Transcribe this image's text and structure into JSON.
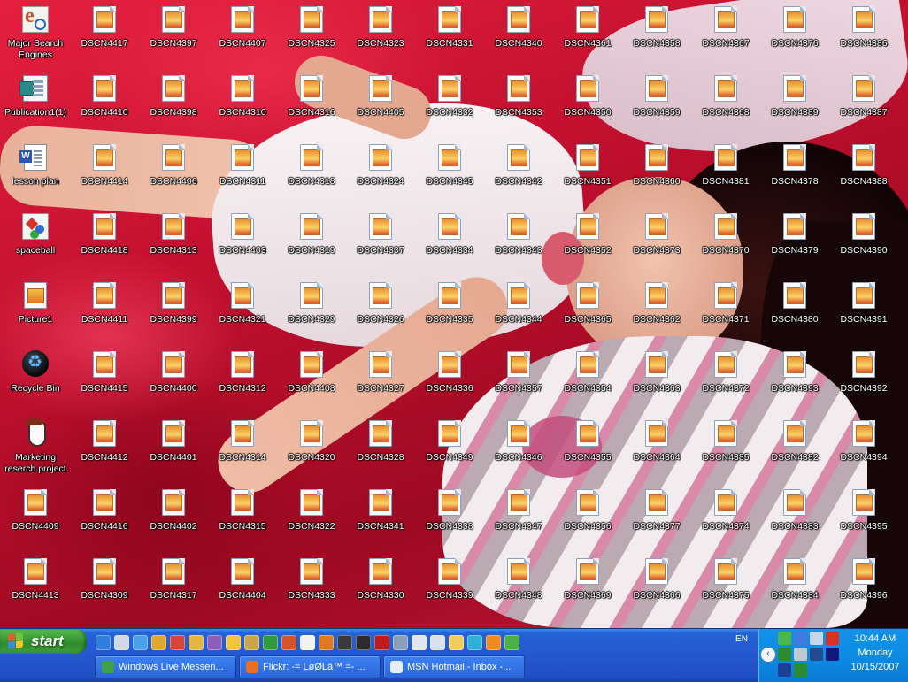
{
  "desktop": {
    "icons": [
      {
        "label": "Major Search Engines",
        "type": "ie"
      },
      {
        "label": "Publication1(1)",
        "type": "pub"
      },
      {
        "label": "lesson plan",
        "type": "doc"
      },
      {
        "label": "spaceball",
        "type": "space"
      },
      {
        "label": "Picture1",
        "type": "pic"
      },
      {
        "label": "Recycle Bin",
        "type": "recycle"
      },
      {
        "label": "Marketing reserch project",
        "type": "penguin"
      },
      {
        "label": "DSCN4409",
        "type": "img"
      },
      {
        "label": "DSCN4413",
        "type": "img"
      },
      {
        "label": "DSCN4417",
        "type": "img"
      },
      {
        "label": "DSCN4410",
        "type": "img"
      },
      {
        "label": "DSCN4414",
        "type": "img"
      },
      {
        "label": "DSCN4418",
        "type": "img"
      },
      {
        "label": "DSCN4411",
        "type": "img"
      },
      {
        "label": "DSCN4415",
        "type": "img"
      },
      {
        "label": "DSCN4412",
        "type": "img"
      },
      {
        "label": "DSCN4416",
        "type": "img"
      },
      {
        "label": "DSCN4309",
        "type": "img"
      },
      {
        "label": "DSCN4397",
        "type": "img"
      },
      {
        "label": "DSCN4398",
        "type": "img"
      },
      {
        "label": "DSCN4406",
        "type": "img"
      },
      {
        "label": "DSCN4313",
        "type": "img"
      },
      {
        "label": "DSCN4399",
        "type": "img"
      },
      {
        "label": "DSCN4400",
        "type": "img"
      },
      {
        "label": "DSCN4401",
        "type": "img"
      },
      {
        "label": "DSCN4402",
        "type": "img"
      },
      {
        "label": "DSCN4317",
        "type": "img"
      },
      {
        "label": "DSCN4407",
        "type": "img"
      },
      {
        "label": "DSCN4310",
        "type": "img"
      },
      {
        "label": "DSCN4311",
        "type": "img"
      },
      {
        "label": "DSCN4403",
        "type": "img"
      },
      {
        "label": "DSCN4321",
        "type": "img"
      },
      {
        "label": "DSCN4312",
        "type": "img"
      },
      {
        "label": "DSCN4314",
        "type": "img"
      },
      {
        "label": "DSCN4315",
        "type": "img"
      },
      {
        "label": "DSCN4404",
        "type": "img"
      },
      {
        "label": "DSCN4325",
        "type": "img"
      },
      {
        "label": "DSCN4316",
        "type": "img"
      },
      {
        "label": "DSCN4318",
        "type": "img"
      },
      {
        "label": "DSCN4319",
        "type": "img"
      },
      {
        "label": "DSCN4329",
        "type": "img"
      },
      {
        "label": "DSCN4408",
        "type": "img"
      },
      {
        "label": "DSCN4320",
        "type": "img"
      },
      {
        "label": "DSCN4322",
        "type": "img"
      },
      {
        "label": "DSCN4333",
        "type": "img"
      },
      {
        "label": "DSCN4323",
        "type": "img"
      },
      {
        "label": "DSCN4405",
        "type": "img"
      },
      {
        "label": "DSCN4324",
        "type": "img"
      },
      {
        "label": "DSCN4337",
        "type": "img"
      },
      {
        "label": "DSCN4326",
        "type": "img"
      },
      {
        "label": "DSCN4327",
        "type": "img"
      },
      {
        "label": "DSCN4328",
        "type": "img"
      },
      {
        "label": "DSCN4341",
        "type": "img"
      },
      {
        "label": "DSCN4330",
        "type": "img"
      },
      {
        "label": "DSCN4331",
        "type": "img"
      },
      {
        "label": "DSCN4332",
        "type": "img"
      },
      {
        "label": "DSCN4345",
        "type": "img"
      },
      {
        "label": "DSCN4334",
        "type": "img"
      },
      {
        "label": "DSCN4335",
        "type": "img"
      },
      {
        "label": "DSCN4336",
        "type": "img"
      },
      {
        "label": "DSCN4349",
        "type": "img"
      },
      {
        "label": "DSCN4338",
        "type": "img"
      },
      {
        "label": "DSCN4339",
        "type": "img"
      },
      {
        "label": "DSCN4340",
        "type": "img"
      },
      {
        "label": "DSCN4353",
        "type": "img"
      },
      {
        "label": "DSCN4342",
        "type": "img"
      },
      {
        "label": "DSCN4343",
        "type": "img"
      },
      {
        "label": "DSCN4344",
        "type": "img"
      },
      {
        "label": "DSCN4357",
        "type": "img"
      },
      {
        "label": "DSCN4346",
        "type": "img"
      },
      {
        "label": "DSCN4347",
        "type": "img"
      },
      {
        "label": "DSCN4348",
        "type": "img"
      },
      {
        "label": "DSCN4361",
        "type": "img"
      },
      {
        "label": "DSCN4350",
        "type": "img"
      },
      {
        "label": "DSCN4351",
        "type": "img"
      },
      {
        "label": "DSCN4352",
        "type": "img"
      },
      {
        "label": "DSCN4365",
        "type": "img"
      },
      {
        "label": "DSCN4354",
        "type": "img"
      },
      {
        "label": "DSCN4355",
        "type": "img"
      },
      {
        "label": "DSCN4356",
        "type": "img"
      },
      {
        "label": "DSCN4369",
        "type": "img"
      },
      {
        "label": "DSCN4358",
        "type": "img"
      },
      {
        "label": "DSCN4359",
        "type": "img"
      },
      {
        "label": "DSCN4360",
        "type": "img"
      },
      {
        "label": "DSCN4373",
        "type": "img"
      },
      {
        "label": "DSCN4362",
        "type": "img"
      },
      {
        "label": "DSCN4363",
        "type": "img"
      },
      {
        "label": "DSCN4364",
        "type": "img"
      },
      {
        "label": "DSCN4377",
        "type": "img"
      },
      {
        "label": "DSCN4366",
        "type": "img"
      },
      {
        "label": "DSCN4367",
        "type": "img"
      },
      {
        "label": "DSCN4368",
        "type": "img"
      },
      {
        "label": "DSCN4381",
        "type": "img"
      },
      {
        "label": "DSCN4370",
        "type": "img"
      },
      {
        "label": "DSCN4371",
        "type": "img"
      },
      {
        "label": "DSCN4372",
        "type": "img"
      },
      {
        "label": "DSCN4385",
        "type": "img"
      },
      {
        "label": "DSCN4374",
        "type": "img"
      },
      {
        "label": "DSCN4375",
        "type": "img"
      },
      {
        "label": "DSCN4376",
        "type": "img"
      },
      {
        "label": "DSCN4389",
        "type": "img"
      },
      {
        "label": "DSCN4378",
        "type": "img"
      },
      {
        "label": "DSCN4379",
        "type": "img"
      },
      {
        "label": "DSCN4380",
        "type": "img"
      },
      {
        "label": "DSCN4393",
        "type": "img"
      },
      {
        "label": "DSCN4382",
        "type": "img"
      },
      {
        "label": "DSCN4383",
        "type": "img"
      },
      {
        "label": "DSCN4384",
        "type": "img"
      },
      {
        "label": "DSCN4386",
        "type": "img"
      },
      {
        "label": "DSCN4387",
        "type": "img"
      },
      {
        "label": "DSCN4388",
        "type": "img"
      },
      {
        "label": "DSCN4390",
        "type": "img"
      },
      {
        "label": "DSCN4391",
        "type": "img"
      },
      {
        "label": "DSCN4392",
        "type": "img"
      },
      {
        "label": "DSCN4394",
        "type": "img"
      },
      {
        "label": "DSCN4395",
        "type": "img"
      },
      {
        "label": "DSCN4396",
        "type": "img"
      }
    ]
  },
  "taskbar": {
    "start_label": "start",
    "quick_launch": [
      {
        "name": "internet-explorer-icon",
        "color": "#2f7fe0"
      },
      {
        "name": "notepad-icon",
        "color": "#cfd8e4"
      },
      {
        "name": "ie-shortcut-icon",
        "color": "#4aa0ea"
      },
      {
        "name": "paint-icon",
        "color": "#e0a72f"
      },
      {
        "name": "pacman-icon",
        "color": "#d9433a"
      },
      {
        "name": "media-icon",
        "color": "#e6b53d"
      },
      {
        "name": "winamp-icon",
        "color": "#8e5fb8"
      },
      {
        "name": "messenger-icon",
        "color": "#f0c43b"
      },
      {
        "name": "globe-icon",
        "color": "#c9a64a"
      },
      {
        "name": "excel-icon",
        "color": "#2e9a3d"
      },
      {
        "name": "powerpoint-icon",
        "color": "#d6542b"
      },
      {
        "name": "word-icon",
        "color": "#f2f2f2"
      },
      {
        "name": "firefox-icon",
        "color": "#e07a22"
      },
      {
        "name": "quicktime-icon",
        "color": "#3a3a3a"
      },
      {
        "name": "notebook-icon",
        "color": "#2b2b2b"
      },
      {
        "name": "opera-icon",
        "color": "#c01a1a"
      },
      {
        "name": "monitor-icon",
        "color": "#8aa0b8"
      },
      {
        "name": "word-doc-icon",
        "color": "#dfe6ef"
      },
      {
        "name": "plane-icon",
        "color": "#d8e2ee"
      },
      {
        "name": "folder-icon",
        "color": "#f2cc5a"
      },
      {
        "name": "player-icon",
        "color": "#2fb0d8"
      },
      {
        "name": "vlc-icon",
        "color": "#f08a1c"
      },
      {
        "name": "network-icon",
        "color": "#49b04a"
      }
    ],
    "tasks": [
      {
        "label": "Windows Live Messen...",
        "color": "#3fa14a"
      },
      {
        "label": "Flickr: -= LøØLä™ =- ...",
        "color": "#e4702a"
      },
      {
        "label": "MSN Hotmail - Inbox -...",
        "color": "#e8eef6"
      }
    ],
    "language": "EN",
    "tray_icons": [
      {
        "name": "messenger-status-icon",
        "color": "#4cb84c"
      },
      {
        "name": "users-icon",
        "color": "#3e7be0"
      },
      {
        "name": "display-icon",
        "color": "#c7d6e8"
      },
      {
        "name": "disconnect-icon",
        "color": "#d9302a"
      },
      {
        "name": "signal-icon",
        "color": "#2e8a2e"
      },
      {
        "name": "settings-icon",
        "color": "#c0c8d4"
      },
      {
        "name": "network-monitor-icon",
        "color": "#244a8f"
      },
      {
        "name": "flag-icon",
        "color": "#10197a"
      },
      {
        "name": "usb-icon",
        "color": "#1d3f96"
      },
      {
        "name": "security-icon",
        "color": "#2d8b36"
      }
    ],
    "clock": {
      "time": "10:44 AM",
      "day": "Monday",
      "date": "10/15/2007"
    }
  }
}
